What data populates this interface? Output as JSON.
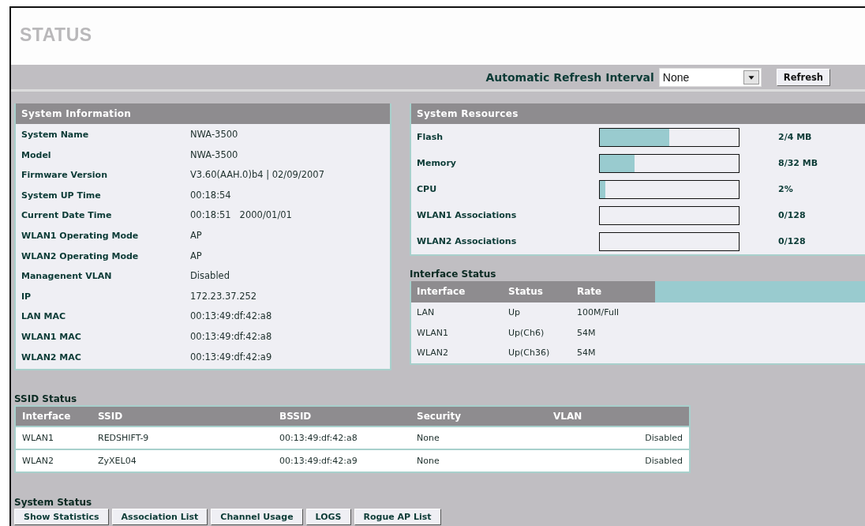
{
  "page": {
    "title": "STATUS"
  },
  "refresh": {
    "label": "Automatic Refresh Interval",
    "interval": "None",
    "button": "Refresh"
  },
  "system_information": {
    "title": "System Information",
    "rows": [
      {
        "label": "System Name",
        "value": "NWA-3500"
      },
      {
        "label": "Model",
        "value": "NWA-3500"
      },
      {
        "label": "Firmware Version",
        "value": "V3.60(AAH.0)b4 | 02/09/2007"
      },
      {
        "label": "System UP Time",
        "value": "00:18:54"
      },
      {
        "label": "Current Date Time",
        "value": "00:18:51   2000/01/01"
      },
      {
        "label": "WLAN1 Operating Mode",
        "value": "AP"
      },
      {
        "label": "WLAN2 Operating Mode",
        "value": "AP"
      },
      {
        "label": "Managenent VLAN",
        "value": "Disabled"
      },
      {
        "label": "IP",
        "value": "172.23.37.252"
      },
      {
        "label": "LAN MAC",
        "value": "00:13:49:df:42:a8"
      },
      {
        "label": "WLAN1 MAC",
        "value": "00:13:49:df:42:a8"
      },
      {
        "label": "WLAN2 MAC",
        "value": "00:13:49:df:42:a9"
      }
    ]
  },
  "system_resources": {
    "title": "System Resources",
    "rows": [
      {
        "label": "Flash",
        "level": 0.5,
        "reading": "2/4 MB"
      },
      {
        "label": "Memory",
        "level": 0.25,
        "reading": "8/32 MB"
      },
      {
        "label": "CPU",
        "level": 0.04,
        "reading": "2%"
      },
      {
        "label": "WLAN1 Associations",
        "reading": "0/128"
      },
      {
        "label": "WLAN2 Associations",
        "reading": "0/128"
      }
    ]
  },
  "interface_status": {
    "title": "Interface Status",
    "columns": [
      "Interface",
      "Status",
      "Rate"
    ],
    "rows": [
      [
        "LAN",
        "Up",
        "100M/Full"
      ],
      [
        "WLAN1",
        "Up(Ch6)",
        "54M"
      ],
      [
        "WLAN2",
        "Up(Ch36)",
        "54M"
      ]
    ]
  },
  "ssid_status": {
    "title": "SSID Status",
    "columns": [
      "Interface",
      "SSID",
      "BSSID",
      "Security",
      "VLAN"
    ],
    "rows": [
      [
        "WLAN1",
        "REDSHIFT-9",
        "00:13:49:df:42:a8",
        "None",
        "Disabled"
      ],
      [
        "WLAN2",
        "ZyXEL04",
        "00:13:49:df:42:a9",
        "None",
        "Disabled"
      ]
    ]
  },
  "system_status": {
    "title": "System Status",
    "buttons": [
      "Show Statistics",
      "Association List",
      "Channel Usage",
      "LOGS",
      "Rogue AP List"
    ]
  }
}
